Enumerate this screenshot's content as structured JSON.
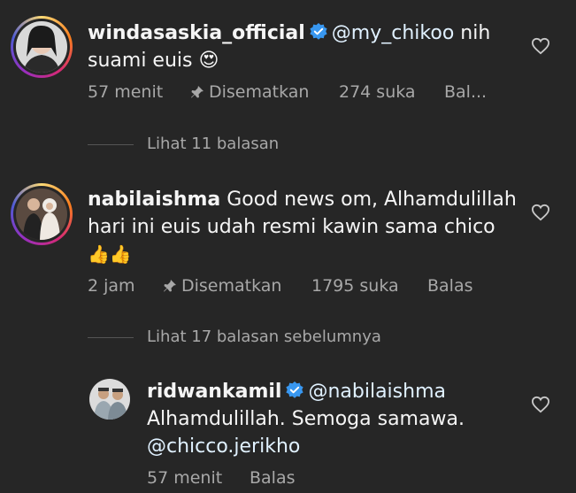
{
  "comments": [
    {
      "username": "windasaskia_official",
      "mention": "@my_chikoo",
      "text_after_mention": " nih",
      "text_line2": "suami euis ",
      "emoji": "😍",
      "time": "57 menit",
      "pinned_label": "Disematkan",
      "likes": "274 suka",
      "reply_label": "Bal...",
      "view_replies": "Lihat 11 balasan"
    },
    {
      "username": "nabilaishma",
      "text_line1": " Good news om, Alhamdulillah",
      "text_line2": "hari ini euis udah resmi kawin sama chico",
      "emoji": "👍👍",
      "time": "2 jam",
      "pinned_label": "Disematkan",
      "likes": "1795 suka",
      "reply_label": "Balas",
      "view_replies": "Lihat 17 balasan sebelumnya"
    }
  ],
  "reply": {
    "username": "ridwankamil",
    "mention": "@nabilaishma",
    "text_line2": "Alhamdulillah. Semoga samawa.",
    "mention2": "@chicco.jerikho",
    "time": "57 menit",
    "reply_label": "Balas"
  },
  "colors": {
    "background": "#262626",
    "text": "#f5f5f5",
    "secondary": "#a8a8a8",
    "verified": "#3897f0"
  },
  "icons": [
    "heart-outline-icon",
    "pin-icon",
    "verified-badge-icon"
  ]
}
